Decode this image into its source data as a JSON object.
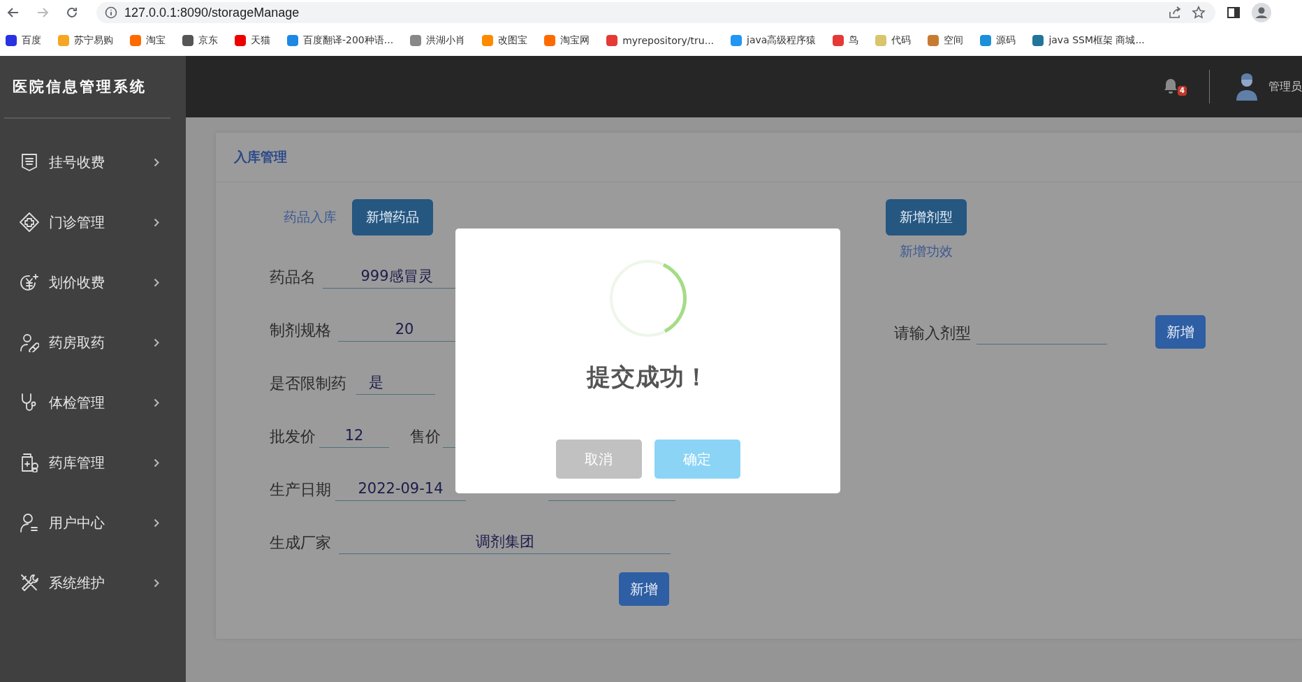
{
  "browser": {
    "url": "127.0.0.1:8090/storageManage",
    "bookmarks": [
      "百度",
      "苏宁易购",
      "淘宝",
      "京东",
      "天猫",
      "百度翻译-200种语...",
      "洪湖小肖",
      "改图宝",
      "淘宝网",
      "myrepository/tru...",
      "java高级程序猿",
      "鸟",
      "代码",
      "空间",
      "源码",
      "java SSM框架 商城..."
    ]
  },
  "sidebar": {
    "title": "医院信息管理系统",
    "items": [
      {
        "label": "挂号收费"
      },
      {
        "label": "门诊管理"
      },
      {
        "label": "划价收费"
      },
      {
        "label": "药房取药"
      },
      {
        "label": "体检管理"
      },
      {
        "label": "药库管理"
      },
      {
        "label": "用户中心"
      },
      {
        "label": "系统维护"
      }
    ]
  },
  "header": {
    "notification_count": "4",
    "user": "管理员"
  },
  "card": {
    "title": "入库管理",
    "tabs": [
      {
        "label": "药品入库",
        "selected": false
      },
      {
        "label": "新增药品",
        "selected": true
      }
    ],
    "form_rows": [
      {
        "fields": [
          {
            "label": "药品名",
            "value": "999感冒灵"
          }
        ]
      },
      {
        "fields": [
          {
            "label": "制剂规格",
            "value": "20"
          }
        ]
      },
      {
        "fields": [
          {
            "label": "是否限制药",
            "value": "是"
          }
        ]
      },
      {
        "fields": [
          {
            "label": "批发价",
            "value": "12"
          },
          {
            "label": "售价"
          }
        ]
      },
      {
        "fields": [
          {
            "label": "生产日期",
            "value": "2022-09-14"
          }
        ],
        "extra_field": true
      },
      {
        "fields": [
          {
            "label": "生成厂家",
            "value": "调剂集团"
          }
        ]
      }
    ],
    "submit_button": "新增",
    "side_tabs": [
      {
        "label": "新增剂型",
        "selected": true
      },
      {
        "label": "新增功效",
        "selected": false
      }
    ],
    "dosage": {
      "label": "请输入剂型",
      "button": "新增"
    }
  },
  "dialog": {
    "title": "提交成功！",
    "buttons": [
      {
        "label": "取消",
        "kind": "cancel"
      },
      {
        "label": "确定",
        "kind": "confirm"
      }
    ]
  }
}
